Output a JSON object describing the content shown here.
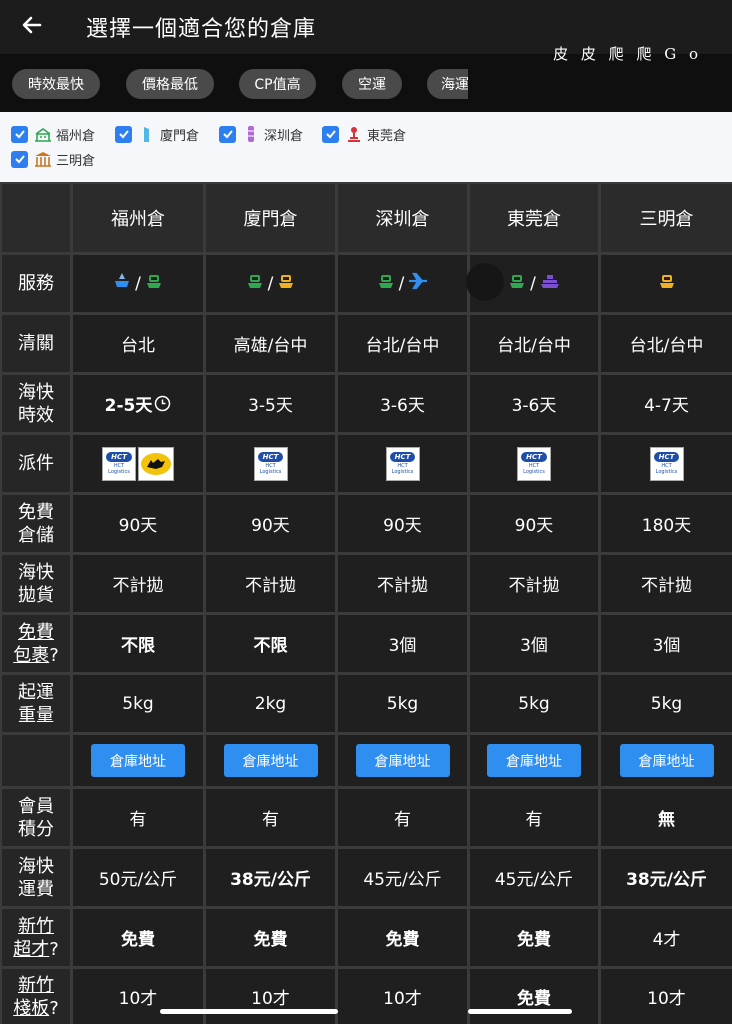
{
  "header": {
    "title": "選擇一個適合您的倉庫",
    "back_icon": "arrow-left-icon"
  },
  "watermark": "皮 皮 爬 爬 G o",
  "filters": [
    "時效最快",
    "價格最低",
    "CP值高",
    "空運",
    "海運"
  ],
  "warehouse_checks": [
    {
      "label": "福州倉",
      "checked": true,
      "icon": "fuzhou-landmark-icon",
      "icon_color": "#2fa84f"
    },
    {
      "label": "廈門倉",
      "checked": true,
      "icon": "xiamen-tower-icon",
      "icon_color": "#4fb6e8"
    },
    {
      "label": "深圳倉",
      "checked": true,
      "icon": "shenzhen-tower-icon",
      "icon_color": "#b06ad8"
    },
    {
      "label": "東莞倉",
      "checked": true,
      "icon": "dongguan-monument-icon",
      "icon_color": "#d8323a"
    },
    {
      "label": "三明倉",
      "checked": true,
      "icon": "sanming-pavilion-icon",
      "icon_color": "#c9761f"
    }
  ],
  "table": {
    "columns": [
      "福州倉",
      "廈門倉",
      "深圳倉",
      "東莞倉",
      "三明倉"
    ],
    "rows": {
      "service": {
        "label": "服務",
        "sep": "/"
      },
      "customs": {
        "label": "清關",
        "values": [
          "台北",
          "高雄/台中",
          "台北/台中",
          "台北/台中",
          "台北/台中"
        ]
      },
      "sea_time": {
        "label": [
          "海快",
          "時效"
        ],
        "values": [
          "2-5天",
          "3-5天",
          "3-6天",
          "3-6天",
          "4-7天"
        ]
      },
      "delivery": {
        "label": "派件",
        "hct_text": "HCT",
        "hct_sub": "HCT Logistics",
        "black_cat": "black-cat-logo"
      },
      "free_storage": {
        "label": [
          "免費",
          "倉儲"
        ],
        "values": [
          "90天",
          "90天",
          "90天",
          "90天",
          "180天"
        ]
      },
      "bulky": {
        "label": [
          "海快",
          "拋貨"
        ],
        "values": [
          "不計拋",
          "不計拋",
          "不計拋",
          "不計拋",
          "不計拋"
        ]
      },
      "free_parcels": {
        "label": [
          "免費",
          "包裹",
          "?"
        ],
        "values": [
          "不限",
          "不限",
          "3個",
          "3個",
          "3個"
        ]
      },
      "min_weight": {
        "label": [
          "起運",
          "重量"
        ],
        "values": [
          "5kg",
          "2kg",
          "5kg",
          "5kg",
          "5kg"
        ]
      },
      "address": {
        "button": "倉庫地址"
      },
      "points": {
        "label": [
          "會員",
          "積分"
        ],
        "values": [
          "有",
          "有",
          "有",
          "有",
          "無"
        ]
      },
      "sea_fee": {
        "label": [
          "海快",
          "運費"
        ],
        "values": [
          "50元/公斤",
          "38元/公斤",
          "45元/公斤",
          "45元/公斤",
          "38元/公斤"
        ]
      },
      "oversize": {
        "label": [
          "新竹",
          "超才",
          "?"
        ],
        "values": [
          "免費",
          "免費",
          "免費",
          "免費",
          "4才"
        ]
      },
      "pallet": {
        "label": [
          "新竹",
          "棧板",
          "?"
        ],
        "values": [
          "10才",
          "10才",
          "10才",
          "免費",
          "10才"
        ]
      }
    }
  },
  "colors": {
    "blue": "#2f8ff0",
    "green": "#2fa84f",
    "yellow": "#f0b020",
    "purple": "#7a4fd0"
  }
}
